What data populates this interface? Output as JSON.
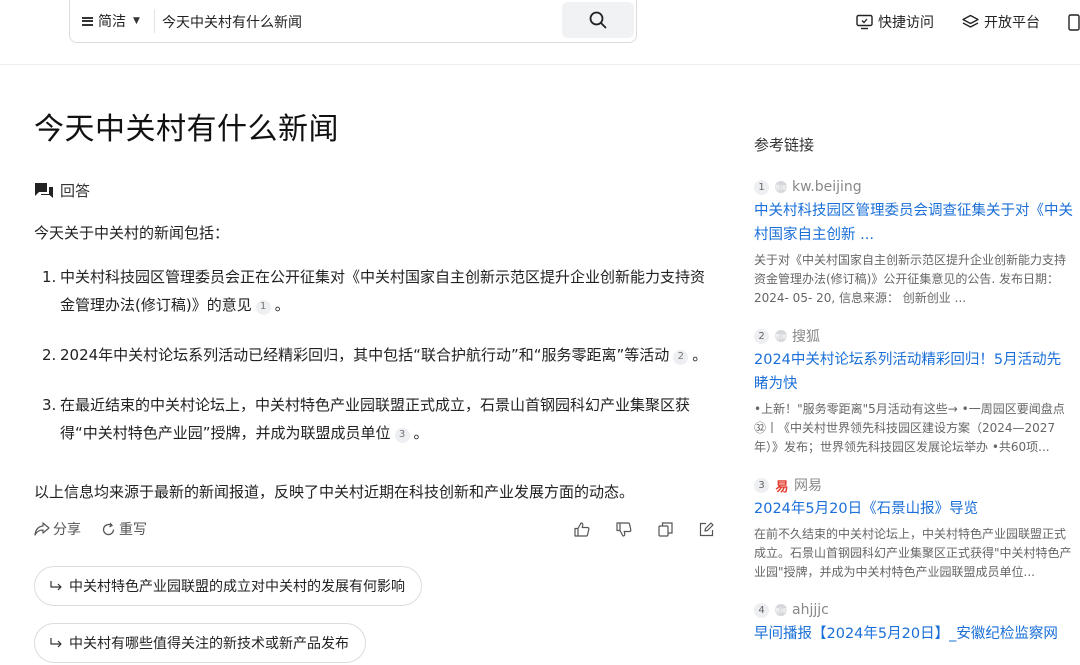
{
  "header": {
    "search_mode": "简洁",
    "search_query": "今天中关村有什么新闻",
    "quick_access_label": "快捷访问",
    "open_platform_label": "开放平台"
  },
  "main": {
    "title": "今天中关村有什么新闻",
    "answer_label": "回答",
    "intro": "今天关于中关村的新闻包括：",
    "items": [
      {
        "num": "1.",
        "text": "中关村科技园区管理委员会正在公开征集对《中关村国家自主创新示范区提升企业创新能力支持资金管理办法(修订稿)》的意见",
        "cite": "1",
        "end": "。"
      },
      {
        "num": "2.",
        "text": "2024年中关村论坛系列活动已经精彩回归，其中包括“联合护航行动”和“服务零距离”等活动",
        "cite": "2",
        "end": "。"
      },
      {
        "num": "3.",
        "text": "在最近结束的中关村论坛上，中关村特色产业园联盟正式成立，石景山首钢园科幻产业集聚区获得“中关村特色产业园”授牌，并成为联盟成员单位",
        "cite": "3",
        "end": "。"
      }
    ],
    "summary": "以上信息均来源于最新的新闻报道，反映了中关村近期在科技创新和产业发展方面的动态。",
    "actions": {
      "share": "分享",
      "rewrite": "重写"
    },
    "suggestions": [
      "中关村特色产业园联盟的成立对中关村的发展有何影响",
      "中关村有哪些值得关注的新技术或新产品发布"
    ]
  },
  "refs": {
    "title": "参考链接",
    "items": [
      {
        "num": "1",
        "favicon": "新闻",
        "source": "kw.beijing",
        "title": "中关村科技园区管理委员会调查征集关于对《中关村国家自主创新 ...",
        "desc": "关于对《中关村国家自主创新示范区提升企业创新能力支持资金管理办法(修订稿)》公开征集意见的公告. 发布日期： 2024- 05- 20, 信息来源： 创新创业 ..."
      },
      {
        "num": "2",
        "favicon": "新闻",
        "source": "搜狐",
        "title": "2024中关村论坛系列活动精彩回归！5月活动先睹为快",
        "desc": "•上新！\"服务零距离\"5月活动有这些→ •一周园区要闻盘点㉜丨《中关村世界领先科技园区建设方案（2024—2027年）》发布；世界领先科技园区发展论坛举办 •共60项..."
      },
      {
        "num": "3",
        "favicon": "易",
        "source": "网易",
        "title": "2024年5月20日《石景山报》导览",
        "desc": "在前不久结束的中关村论坛上，中关村特色产业园联盟正式成立。石景山首钢园科幻产业集聚区正式获得\"中关村特色产业园\"授牌，并成为中关村特色产业园联盟成员单位..."
      },
      {
        "num": "4",
        "favicon": "新闻",
        "source": "ahjjjc",
        "title": "早间播报【2024年5月20日】_安徽纪检监察网",
        "desc": ""
      }
    ]
  }
}
